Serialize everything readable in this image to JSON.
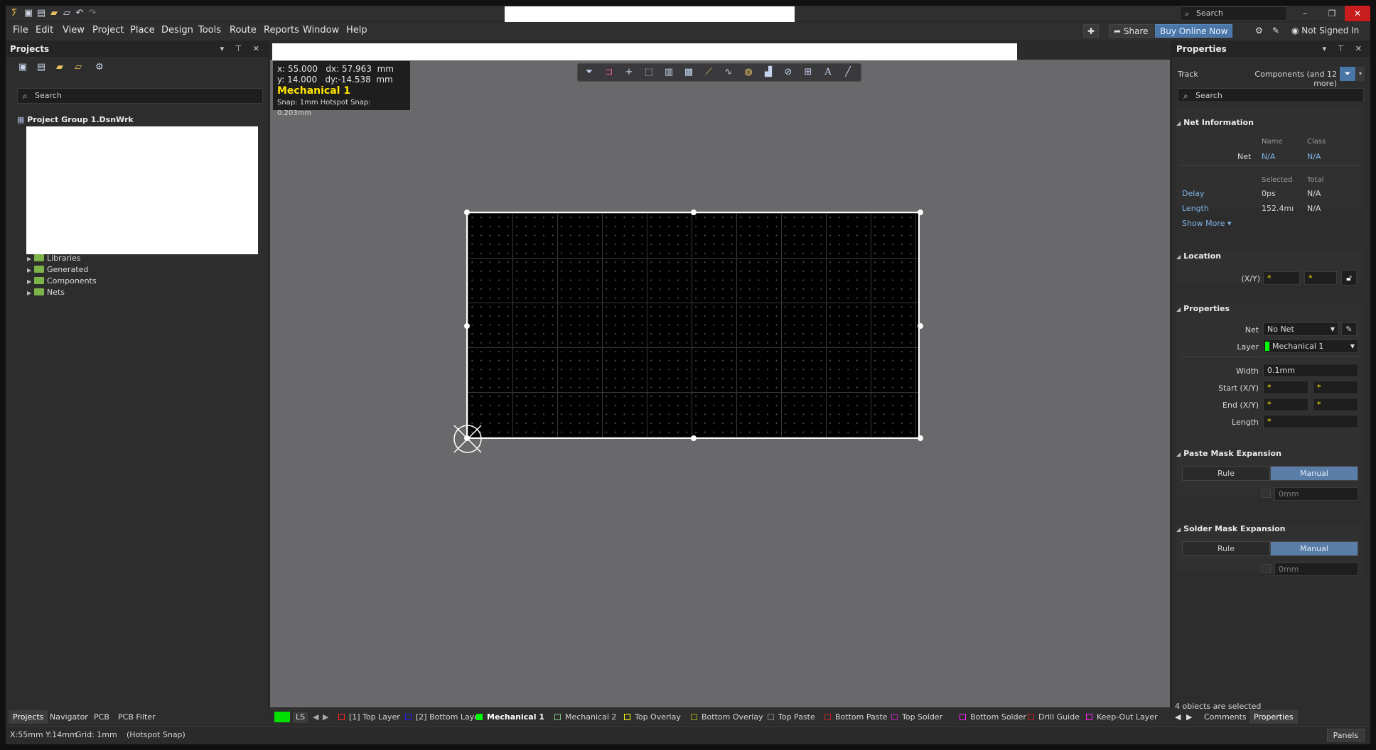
{
  "titlebar": {
    "search_placeholder": "Search",
    "buttons": {
      "minimize": "–",
      "restore": "❐",
      "close": "✕"
    }
  },
  "menu": {
    "items": [
      "File",
      "Edit",
      "View",
      "Project",
      "Place",
      "Design",
      "Tools",
      "Route",
      "Reports",
      "Window",
      "Help"
    ],
    "share_label": "Share",
    "buy_label": "Buy Online Now",
    "signin_label": "Not Signed In"
  },
  "projects_panel": {
    "title": "Projects",
    "search_placeholder": "Search",
    "root": "Project Group 1.DsnWrk",
    "tree": [
      "Libraries",
      "Generated",
      "Components",
      "Nets"
    ]
  },
  "left_tabs": [
    "Projects",
    "Navigator",
    "PCB",
    "PCB Filter"
  ],
  "hud": {
    "line1": "x: 55.000   dx: 57.963  mm",
    "line2": "y: 14.000   dy:-14.538  mm",
    "layer": "Mechanical 1",
    "snap": "Snap: 1mm Hotspot Snap: 0.203mm"
  },
  "properties": {
    "title": "Properties",
    "type_label": "Track",
    "filter_text": "Components (and 12 more)",
    "search_placeholder": "Search",
    "net_info": {
      "title": "Net Information",
      "col_name": "Name",
      "col_class": "Class",
      "net_label": "Net",
      "net_name": "N/A",
      "net_class": "N/A",
      "col_selected": "Selected",
      "col_total": "Total",
      "delay_label": "Delay",
      "delay_selected": "0ps",
      "delay_total": "N/A",
      "length_label": "Length",
      "length_selected": "152.4mı",
      "length_total": "N/A",
      "show_more": "Show More ▾"
    },
    "location": {
      "title": "Location",
      "xy_label": "(X/Y)",
      "x": "*",
      "y": "*"
    },
    "props": {
      "title": "Properties",
      "net_label": "Net",
      "net_value": "No Net",
      "layer_label": "Layer",
      "layer_value": "Mechanical 1",
      "layer_color": "#00ff00",
      "width_label": "Width",
      "width_value": "0.1mm",
      "start_label": "Start (X/Y)",
      "end_label": "End (X/Y)",
      "length_label": "Length",
      "star": "*"
    },
    "paste_mask": {
      "title": "Paste Mask Expansion",
      "rule": "Rule",
      "manual": "Manual",
      "value": "0mm"
    },
    "solder_mask": {
      "title": "Solder Mask Expansion",
      "rule": "Rule",
      "manual": "Manual",
      "value": "0mm"
    },
    "selection_status": "4 objects are selected"
  },
  "right_tabs": [
    "Comments",
    "Properties"
  ],
  "layers": {
    "ls": "LS",
    "items": [
      {
        "name": "[1] Top Layer",
        "color": "#ff2020"
      },
      {
        "name": "[2] Bottom Layer",
        "color": "#2020ff"
      },
      {
        "name": "Mechanical 1",
        "color": "#00ff00"
      },
      {
        "name": "Mechanical 2",
        "color": "#80c080"
      },
      {
        "name": "Top Overlay",
        "color": "#ffff00"
      },
      {
        "name": "Bottom Overlay",
        "color": "#a0a020"
      },
      {
        "name": "Top Paste",
        "color": "#808080"
      },
      {
        "name": "Bottom Paste",
        "color": "#c02020"
      },
      {
        "name": "Top Solder",
        "color": "#c020c0"
      },
      {
        "name": "Bottom Solder",
        "color": "#ff20ff"
      },
      {
        "name": "Drill Guide",
        "color": "#c02020"
      },
      {
        "name": "Keep-Out Layer",
        "color": "#ff20ff"
      }
    ]
  },
  "status": {
    "coords": "X:55mm Y:14mm",
    "grid": "Grid: 1mm",
    "snap": "(Hotspot Snap)",
    "panels": "Panels"
  }
}
